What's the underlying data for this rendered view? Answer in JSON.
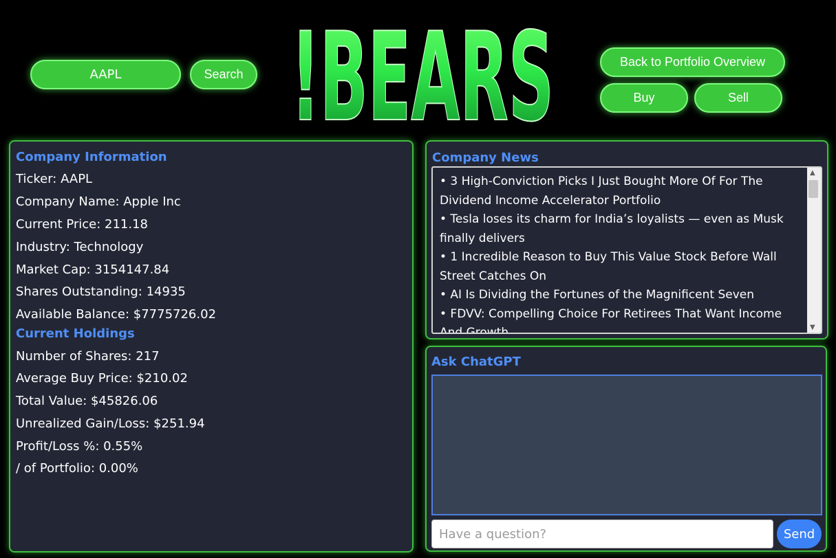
{
  "header": {
    "ticker_value": "AAPL",
    "search_label": "Search",
    "logo_text": "!BEARS",
    "back_label": "Back to Portfolio Overview",
    "buy_label": "Buy",
    "sell_label": "Sell"
  },
  "company_info": {
    "title": "Company Information",
    "lines": [
      "Ticker: AAPL",
      "Company Name: Apple Inc",
      "Current Price: 211.18",
      "Industry: Technology",
      "Market Cap: 3154147.84",
      "Shares Outstanding: 14935",
      "Available Balance: $7775726.02"
    ]
  },
  "holdings": {
    "title": "Current Holdings",
    "lines": [
      "Number of Shares: 217",
      "Average Buy Price: $210.02",
      "Total Value: $45826.06",
      "Unrealized Gain/Loss: $251.94",
      "Profit/Loss %: 0.55%",
      "/ of Portfolio: 0.00%"
    ]
  },
  "news": {
    "title": "Company News",
    "items": [
      "• 3 High-Conviction Picks I Just Bought More Of For The Dividend Income Accelerator Portfolio",
      "• Tesla loses its charm for India’s loyalists — even as Musk finally delivers",
      "• 1 Incredible Reason to Buy This Value Stock Before Wall Street Catches On",
      "• AI Is Dividing the Fortunes of the Magnificent Seven",
      "• FDVV: Compelling Choice For Retirees That Want Income And Growth"
    ]
  },
  "chat": {
    "title": "Ask ChatGPT",
    "output_text": "",
    "input_value": "",
    "input_placeholder": "Have a question?",
    "send_label": "Send"
  },
  "icons": {
    "scroll_up": "chevron-up-icon",
    "scroll_down": "chevron-down-icon"
  },
  "colors": {
    "accent_green": "#3cc83c",
    "heading_blue": "#4f8ff7",
    "panel_background": "#232735",
    "send_blue": "#3b82f6",
    "page_background": "#000000"
  }
}
